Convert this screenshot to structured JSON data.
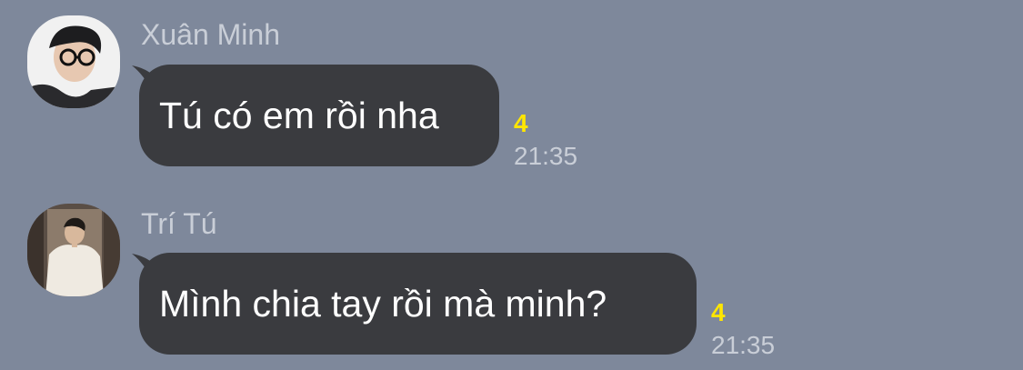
{
  "messages": [
    {
      "sender": "Xuân Minh",
      "text": "Tú có em rồi nha",
      "unread_count": "4",
      "time": "21:35",
      "avatar": "person-with-glasses-photo"
    },
    {
      "sender": "Trí Tú",
      "text": "Mình chia tay rồi mà minh?",
      "unread_count": "4",
      "time": "21:35",
      "avatar": "person-in-white-sweater-photo"
    }
  ],
  "colors": {
    "background": "#7e889b",
    "bubble": "#3a3b3f",
    "bubble_text": "#ffffff",
    "meta_text": "#c9ced7",
    "unread": "#ffe600"
  }
}
